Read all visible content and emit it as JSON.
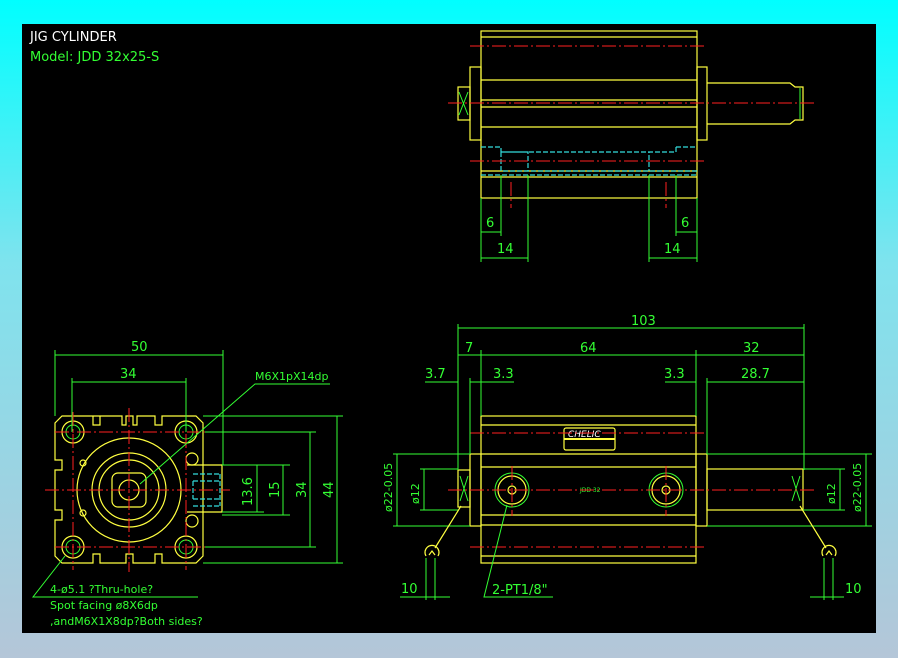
{
  "title": "JIG CYLINDER",
  "model": "Model: JDD 32x25-S",
  "colors": {
    "background_top": "#00ffff",
    "background_bottom": "#b4c6d8",
    "canvas": "#000000",
    "outline": "#ffff40",
    "dimension": "#33ff33",
    "centerline": "#ff2020",
    "hidden": "#33dddd"
  },
  "top_view": {
    "dims": [
      "6",
      "14",
      "6",
      "14"
    ]
  },
  "front_view": {
    "dims": [
      "50",
      "34",
      "13.6",
      "15",
      "34",
      "44"
    ],
    "thread_callout": "M6X1pX14dp",
    "hole_note": [
      "4-ø5.1 ?Thru-hole?",
      "Spot facing ø8X6dp",
      ",andM6X1X8dp?Both sides?"
    ]
  },
  "side_view": {
    "dims": [
      "103",
      "7",
      "64",
      "32",
      "3.7",
      "3.3",
      "3.3",
      "28.7",
      "ø22-0.05",
      "ø12",
      "ø12",
      "ø22-0.05",
      "10",
      "10"
    ],
    "port_callout": "2-PT1/8\"",
    "nameplate": "CHELIC",
    "body_marking": "JDD 32"
  }
}
